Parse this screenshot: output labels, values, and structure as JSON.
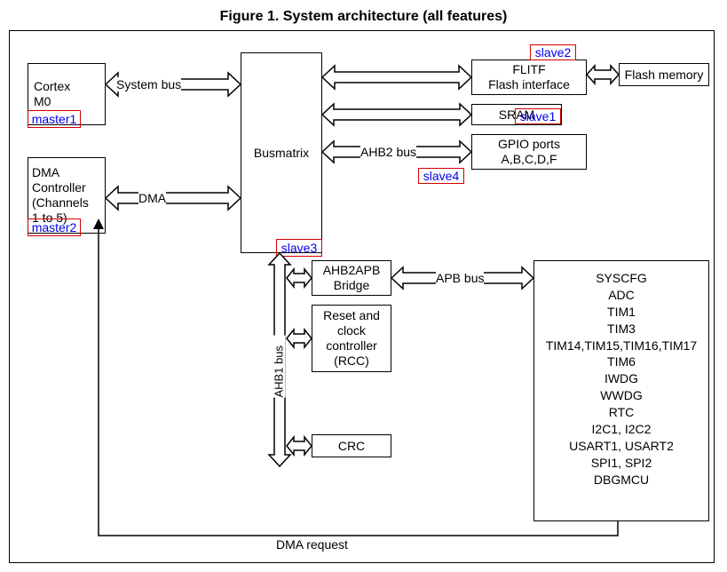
{
  "title": "Figure 1. System architecture (all features)",
  "boxes": {
    "cortex": "Cortex\nM0",
    "dma": "DMA\nController\n(Channels\n1 to 5)",
    "busmatrix": "Busmatrix",
    "flitf": "FLITF\nFlash interface",
    "flashmem": "Flash memory",
    "sram": "SRAM",
    "gpio": "GPIO ports\nA,B,C,D,F",
    "bridge": "AHB2APB\nBridge",
    "rcc": "Reset and\nclock\ncontroller\n(RCC)",
    "crc": "CRC"
  },
  "annotations": {
    "master1": "master1",
    "master2": "master2",
    "slave1": "slave1",
    "slave2": "slave2",
    "slave3": "slave3",
    "slave4": "slave4"
  },
  "buses": {
    "system": "System bus",
    "dma_label": "DMA",
    "ahb2": "AHB2 bus",
    "ahb1": "AHB1 bus",
    "apb": "APB bus",
    "dma_req": "DMA request"
  },
  "apb_peripherals": [
    "SYSCFG",
    "ADC",
    "TIM1",
    "TIM3",
    "TIM14,TIM15,TIM16,TIM17",
    "TIM6",
    "IWDG",
    "WWDG",
    "RTC",
    "I2C1, I2C2",
    "USART1, USART2",
    "SPI1, SPI2",
    "DBGMCU"
  ]
}
